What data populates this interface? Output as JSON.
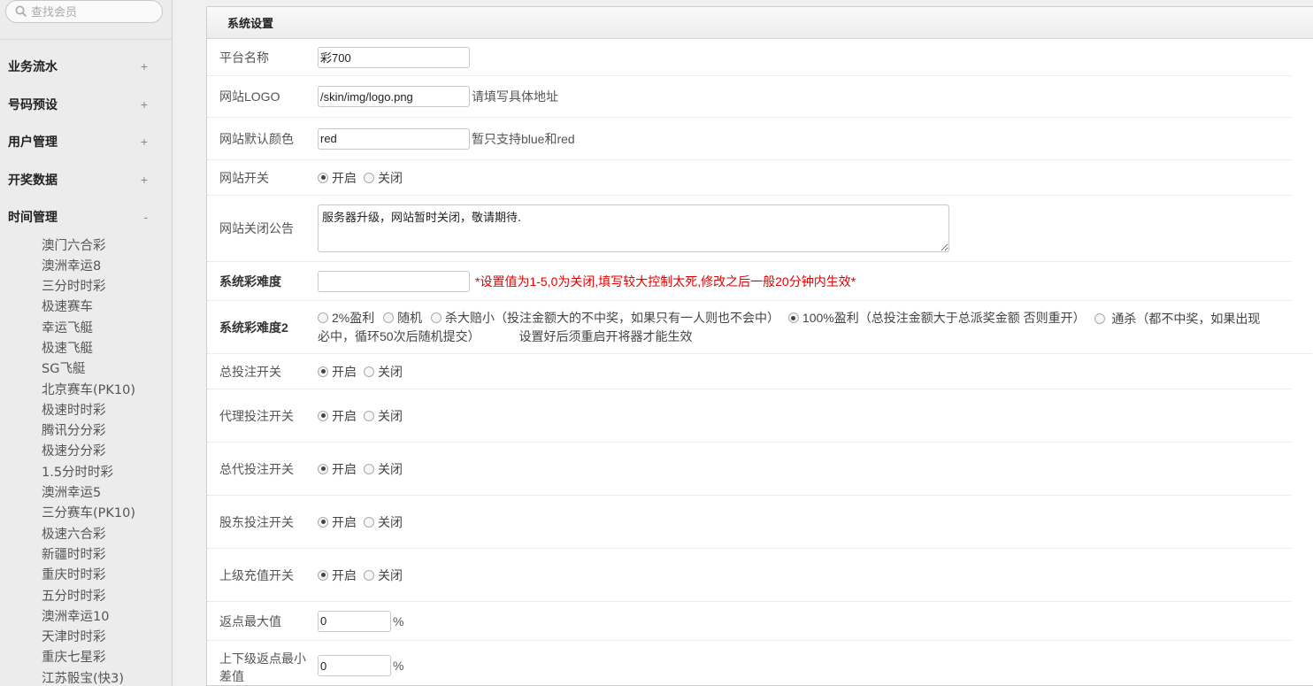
{
  "sidebar": {
    "search_placeholder": "查找会员",
    "menu": [
      {
        "label": "业务流水",
        "toggle": "+"
      },
      {
        "label": "号码预设",
        "toggle": "+"
      },
      {
        "label": "用户管理",
        "toggle": "+"
      },
      {
        "label": "开奖数据",
        "toggle": "+"
      },
      {
        "label": "时间管理",
        "toggle": "-"
      }
    ],
    "submenu": [
      "澳门六合彩",
      "澳洲幸运8",
      "三分时时彩",
      "极速赛车",
      "幸运飞艇",
      "极速飞艇",
      "SG飞艇",
      "北京赛车(PK10)",
      "极速时时彩",
      "腾讯分分彩",
      "极速分分彩",
      "1.5分时时彩",
      "澳洲幸运5",
      "三分赛车(PK10)",
      "极速六合彩",
      "新疆时时彩",
      "重庆时时彩",
      "五分时时彩",
      "澳洲幸运10",
      "天津时时彩",
      "重庆七星彩",
      "江苏骰宝(快3)"
    ]
  },
  "panel": {
    "title": "系统设置",
    "platform_name": {
      "label": "平台名称",
      "value": "彩700"
    },
    "logo": {
      "label": "网站LOGO",
      "value": "/skin/img/logo.png",
      "hint": "请填写具体地址"
    },
    "color": {
      "label": "网站默认颜色",
      "value": "red",
      "hint": "暂只支持blue和red"
    },
    "site_switch": {
      "label": "网站开关",
      "on": "开启",
      "off": "关闭"
    },
    "close_notice": {
      "label": "网站关闭公告",
      "value": "服务器升级，网站暂时关闭，敬请期待."
    },
    "difficulty": {
      "label": "系统彩难度",
      "value": "",
      "hint": "*设置值为1-5,0为关闭,填写较大控制太死,修改之后一般20分钟内生效*"
    },
    "difficulty2": {
      "label": "系统彩难度2",
      "opt1": "2%盈利",
      "opt2": "随机",
      "opt3": "杀大赔小（投注金额大的不中奖，如果只有一人则也不会中）",
      "opt4": "100%盈利（总投注金额大于总派奖金额 否则重开）",
      "opt5": "通杀（都不中奖，如果出现必中，循环50次后随机提交）",
      "note": "设置好后须重启开将器才能生效"
    },
    "total_bet": {
      "label": "总投注开关",
      "on": "开启",
      "off": "关闭"
    },
    "agent_bet": {
      "label": "代理投注开关",
      "on": "开启",
      "off": "关闭"
    },
    "general_agent_bet": {
      "label": "总代投注开关",
      "on": "开启",
      "off": "关闭"
    },
    "shareholder_bet": {
      "label": "股东投注开关",
      "on": "开启",
      "off": "关闭"
    },
    "upper_recharge": {
      "label": "上级充值开关",
      "on": "开启",
      "off": "关闭"
    },
    "rebate_max": {
      "label": "返点最大值",
      "value": "0",
      "unit": "%"
    },
    "rebate_diff": {
      "label": "上下级返点最小差值",
      "value": "0",
      "unit": "%"
    }
  }
}
